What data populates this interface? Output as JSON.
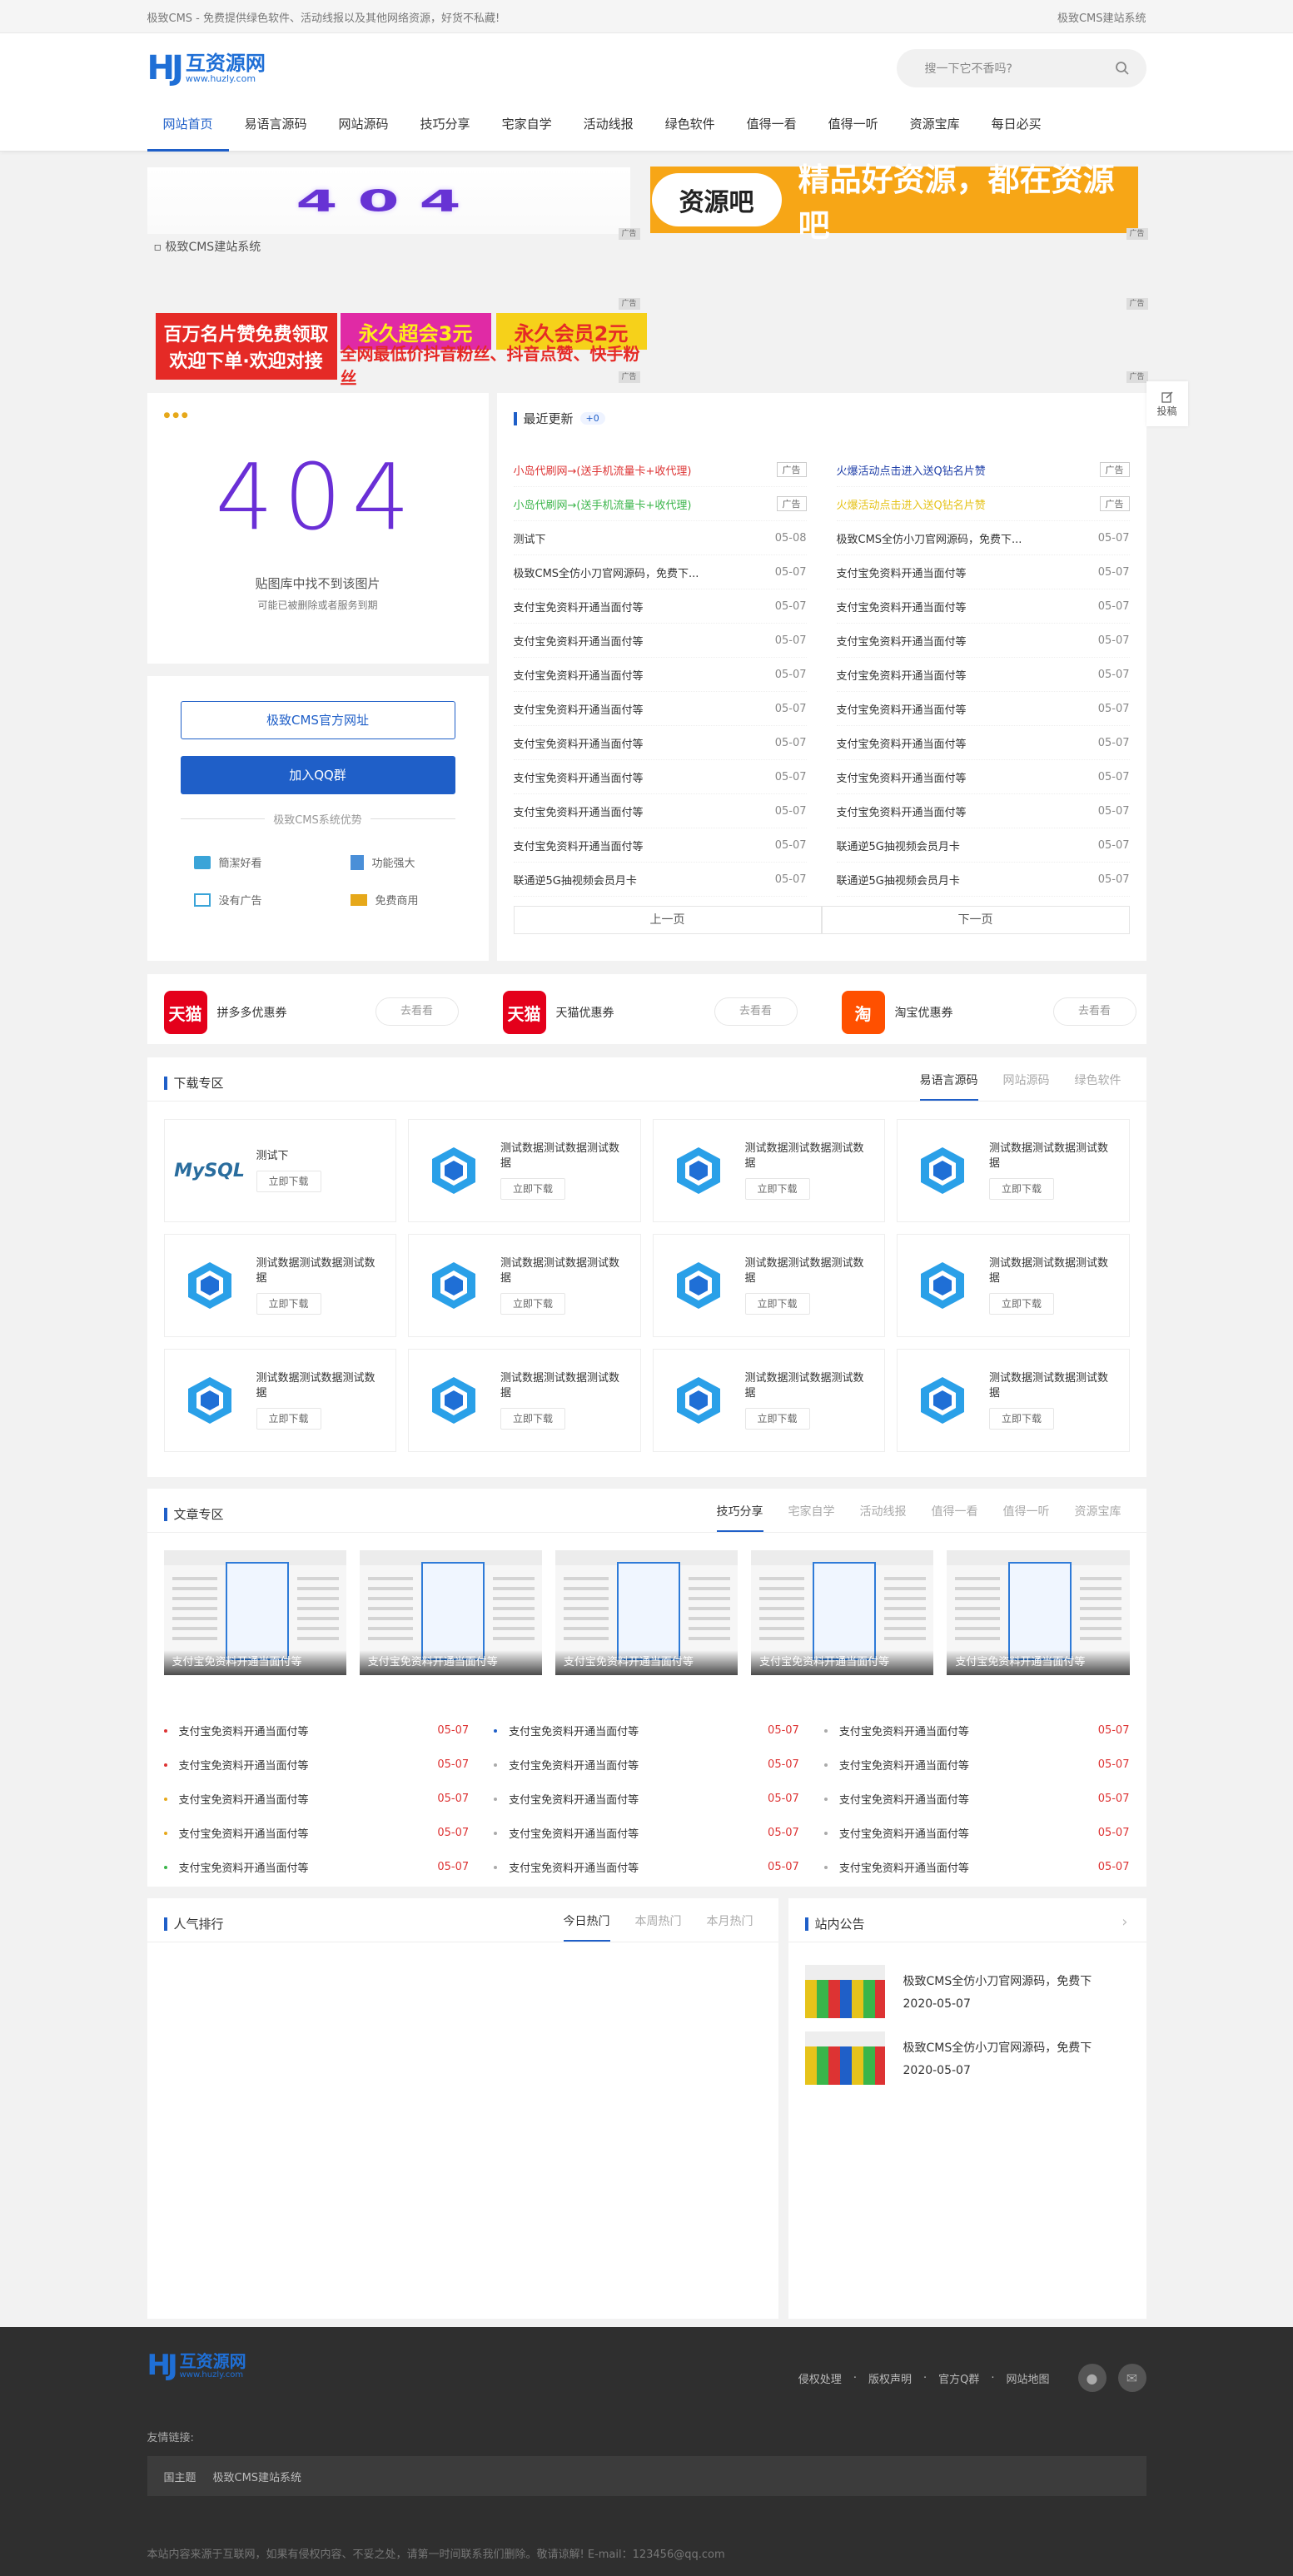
{
  "topbar": {
    "left": "极致CMS - 免费提供绿色软件、活动线报以及其他网络资源，好货不私藏!",
    "right": "极致CMS建站系统"
  },
  "header": {
    "logo_mark": "HJ",
    "logo_cn": "互资源网",
    "logo_en": "www.huzly.com",
    "search_placeholder": "搜一下它不香吗?"
  },
  "nav": [
    "网站首页",
    "易语言源码",
    "网站源码",
    "技巧分享",
    "宅家自学",
    "活动线报",
    "绿色软件",
    "值得一看",
    "值得一听",
    "资源宝库",
    "每日必买"
  ],
  "ads": {
    "adtag": "广告",
    "ad404_text": "404",
    "zyb_logo": "资源吧",
    "zyb_text": "精品好资源，都在资源吧",
    "broken_alt": "极致CMS建站系统",
    "banner_b1_line1": "百万名片赞免费领取",
    "banner_b1_line2": "欢迎下单·欢迎对接",
    "banner_b2a": "永久超会3元",
    "banner_b2b": "永久会员2元",
    "banner_b2c": "全网最低价抖音粉丝、抖音点赞、快手粉丝"
  },
  "sidebar": {
    "img404": "404",
    "img_caption1": "贴图库中找不到该图片",
    "img_caption2": "可能已被删除或者服务到期",
    "btn_official": "极致CMS官方网址",
    "btn_qq": "加入QQ群",
    "adv_title": "极致CMS系统优势",
    "features": [
      "簡潔好看",
      "功能强大",
      "没有广告",
      "免费商用"
    ]
  },
  "latest": {
    "title": "最近更新",
    "count": "+0",
    "ad_tag": "广告",
    "left": [
      {
        "t": "小岛代刷网→(送手机流量卡+收代理)",
        "d": "",
        "color": "#d33",
        "ad": true
      },
      {
        "t": "小岛代刷网→(送手机流量卡+收代理)",
        "d": "",
        "color": "#3ab54a",
        "ad": true
      },
      {
        "t": "测试下",
        "d": "05-08"
      },
      {
        "t": "极致CMS全仿小刀官网源码，免费下...",
        "d": "05-07"
      },
      {
        "t": "支付宝免资料开通当面付等",
        "d": "05-07"
      },
      {
        "t": "支付宝免资料开通当面付等",
        "d": "05-07"
      },
      {
        "t": "支付宝免资料开通当面付等",
        "d": "05-07"
      },
      {
        "t": "支付宝免资料开通当面付等",
        "d": "05-07"
      },
      {
        "t": "支付宝免资料开通当面付等",
        "d": "05-07"
      },
      {
        "t": "支付宝免资料开通当面付等",
        "d": "05-07"
      },
      {
        "t": "支付宝免资料开通当面付等",
        "d": "05-07"
      },
      {
        "t": "支付宝免资料开通当面付等",
        "d": "05-07"
      },
      {
        "t": "联通逆5G抽视频会员月卡",
        "d": "05-07"
      }
    ],
    "right": [
      {
        "t": "火爆活动点击进入送Q钻名片赞",
        "d": "",
        "color": "#1f3fa8",
        "ad": true
      },
      {
        "t": "火爆活动点击进入送Q钻名片赞",
        "d": "",
        "color": "#e6c31a",
        "ad": true
      },
      {
        "t": "极致CMS全仿小刀官网源码，免费下...",
        "d": "05-07"
      },
      {
        "t": "支付宝免资料开通当面付等",
        "d": "05-07"
      },
      {
        "t": "支付宝免资料开通当面付等",
        "d": "05-07"
      },
      {
        "t": "支付宝免资料开通当面付等",
        "d": "05-07"
      },
      {
        "t": "支付宝免资料开通当面付等",
        "d": "05-07"
      },
      {
        "t": "支付宝免资料开通当面付等",
        "d": "05-07"
      },
      {
        "t": "支付宝免资料开通当面付等",
        "d": "05-07"
      },
      {
        "t": "支付宝免资料开通当面付等",
        "d": "05-07"
      },
      {
        "t": "支付宝免资料开通当面付等",
        "d": "05-07"
      },
      {
        "t": "联通逆5G抽视频会员月卡",
        "d": "05-07"
      },
      {
        "t": "联通逆5G抽视频会员月卡",
        "d": "05-07"
      }
    ],
    "prev": "上一页",
    "next": "下一页"
  },
  "float_btn": "投稿",
  "coupons": [
    {
      "icon": "天猫",
      "name": "拼多多优惠券",
      "btn": "去看看",
      "color": "#e4001b"
    },
    {
      "icon": "天猫",
      "name": "天猫优惠券",
      "btn": "去看看",
      "color": "#e4001b"
    },
    {
      "icon": "淘",
      "name": "淘宝优惠券",
      "btn": "去看看",
      "color": "#ff5000"
    }
  ],
  "downloads": {
    "title": "下载专区",
    "tabs": [
      "易语言源码",
      "网站源码",
      "绿色软件"
    ],
    "btn": "立即下载",
    "items": [
      "测试下",
      "测试数据测试数据测试数据",
      "测试数据测试数据测试数据",
      "测试数据测试数据测试数据",
      "测试数据测试数据测试数据",
      "测试数据测试数据测试数据",
      "测试数据测试数据测试数据",
      "测试数据测试数据测试数据",
      "测试数据测试数据测试数据",
      "测试数据测试数据测试数据",
      "测试数据测试数据测试数据",
      "测试数据测试数据测试数据"
    ],
    "mysql_label": "MySQL"
  },
  "articles": {
    "title": "文章专区",
    "tabs": [
      "技巧分享",
      "宅家自学",
      "活动线报",
      "值得一看",
      "值得一听",
      "资源宝库"
    ],
    "thumb_caption": "支付宝免资料开通当面付等",
    "list": [
      {
        "t": "支付宝免资料开通当面付等",
        "d": "05-07",
        "dot": "#d33"
      },
      {
        "t": "支付宝免资料开通当面付等",
        "d": "05-07",
        "dot": "#d33"
      },
      {
        "t": "支付宝免资料开通当面付等",
        "d": "05-07",
        "dot": "#e6a81a"
      },
      {
        "t": "支付宝免资料开通当面付等",
        "d": "05-07",
        "dot": "#e6a81a"
      },
      {
        "t": "支付宝免资料开通当面付等",
        "d": "05-07",
        "dot": "#3ab54a"
      },
      {
        "t": "支付宝免资料开通当面付等",
        "d": "05-07",
        "dot": "#1f5fc8"
      },
      {
        "t": "支付宝免资料开通当面付等",
        "d": "05-07",
        "dot": "#aaa"
      },
      {
        "t": "支付宝免资料开通当面付等",
        "d": "05-07",
        "dot": "#aaa"
      },
      {
        "t": "支付宝免资料开通当面付等",
        "d": "05-07",
        "dot": "#aaa"
      },
      {
        "t": "支付宝免资料开通当面付等",
        "d": "05-07",
        "dot": "#aaa"
      },
      {
        "t": "支付宝免资料开通当面付等",
        "d": "05-07",
        "dot": "#aaa"
      },
      {
        "t": "支付宝免资料开通当面付等",
        "d": "05-07",
        "dot": "#aaa"
      },
      {
        "t": "支付宝免资料开通当面付等",
        "d": "05-07",
        "dot": "#aaa"
      },
      {
        "t": "支付宝免资料开通当面付等",
        "d": "05-07",
        "dot": "#aaa"
      },
      {
        "t": "支付宝免资料开通当面付等",
        "d": "05-07",
        "dot": "#aaa"
      }
    ]
  },
  "ranking": {
    "title": "人气排行",
    "tabs": [
      "今日热门",
      "本周热门",
      "本月热门"
    ]
  },
  "notice": {
    "title": "站内公告",
    "items": [
      {
        "t": "极致CMS全仿小刀官网源码，免费下",
        "d": "2020-05-07"
      },
      {
        "t": "极致CMS全仿小刀官网源码，免费下",
        "d": "2020-05-07"
      }
    ]
  },
  "footer": {
    "links": [
      "侵权处理",
      "版权声明",
      "官方Q群",
      "网站地图"
    ],
    "sep": "·",
    "friend_label": "友情链接:",
    "friends": [
      "国主题",
      "极致CMS建站系统"
    ],
    "copyright": "本站内容来源于互联网，如果有侵权内容、不妥之处，请第一时间联系我们删除。敬请谅解! E-mail：123456@qq.com"
  }
}
